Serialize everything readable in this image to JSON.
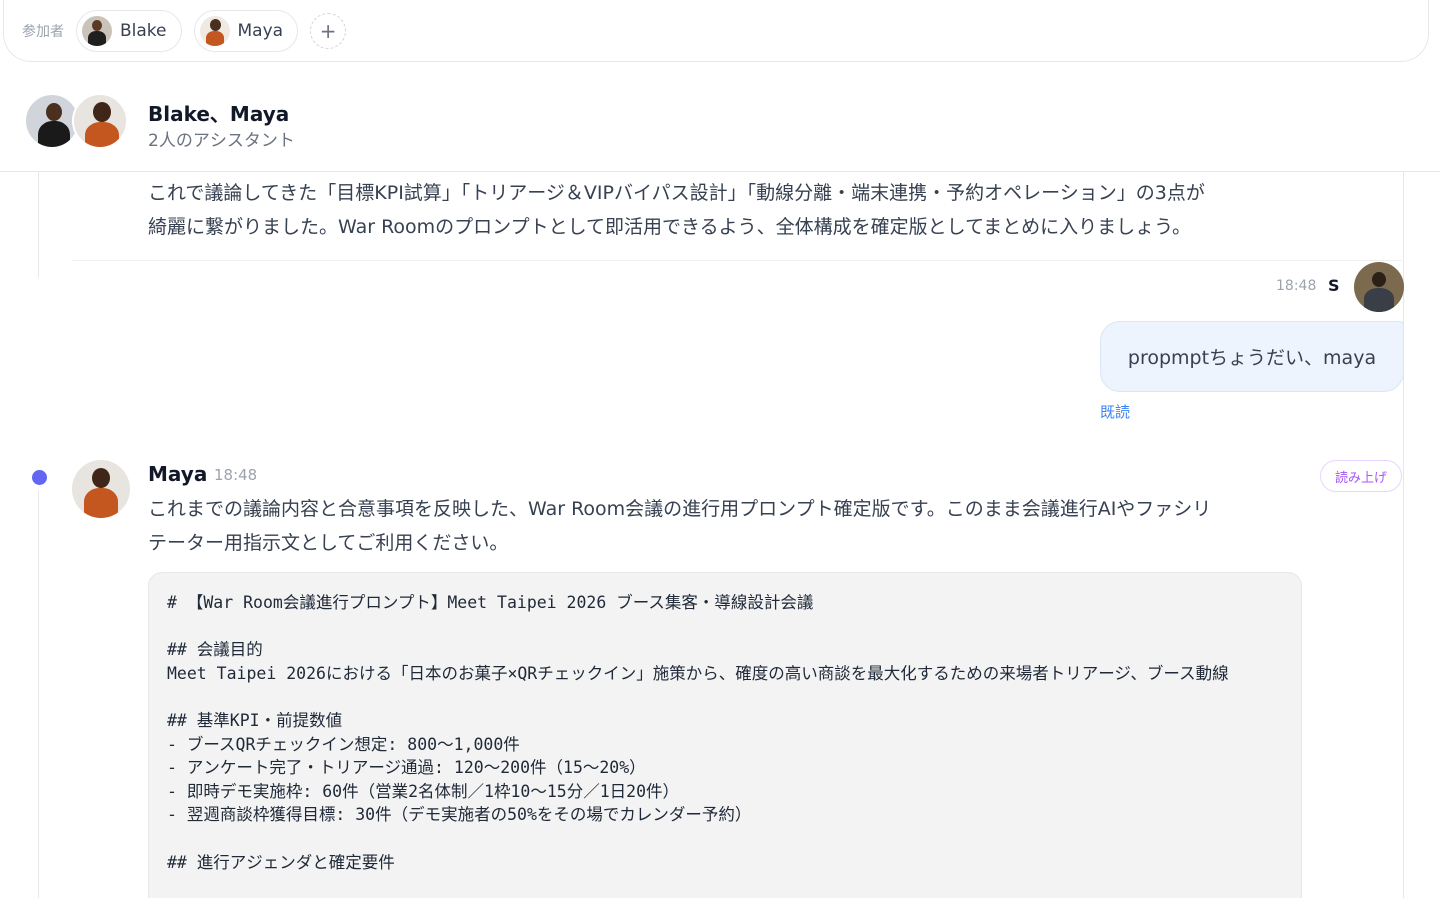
{
  "participants": {
    "label": "参加者",
    "chips": [
      {
        "name": "Blake"
      },
      {
        "name": "Maya"
      }
    ],
    "add_symbol": "+"
  },
  "header": {
    "title": "Blake、Maya",
    "subtitle": "2人のアシスタント"
  },
  "previous_message": {
    "lines": [
      "これで議論してきた「目標KPI試算」「トリアージ＆VIPバイパス設計」「動線分離・端末連携・予約オペレーション」の3点が",
      "綺麗に繋がりました。War Roomのプロンプトとして即活用できるよう、全体構成を確定版としてまとめに入りましょう。"
    ]
  },
  "user_message": {
    "time": "18:48",
    "sender": "S",
    "text": "propmptちょうだい、maya",
    "status": "既読"
  },
  "maya_message": {
    "sender": "Maya",
    "time": "18:48",
    "read_aloud": "読み上げ",
    "lines": [
      "これまでの議論内容と合意事項を反映した、War Room会議の進行用プロンプト確定版です。このまま会議進行AIやファシリ",
      "テーター用指示文としてご利用ください。"
    ],
    "code_lines": [
      "# 【War Room会議進行プロンプト】Meet Taipei 2026 ブース集客・導線設計会議",
      "",
      "## 会議目的",
      "Meet Taipei 2026における「日本のお菓子×QRチェックイン」施策から、確度の高い商談を最大化するための来場者トリアージ、ブース動線",
      "",
      "## 基準KPI・前提数値",
      "- ブースQRチェックイン想定: 800〜1,000件",
      "- アンケート完了・トリアージ通過: 120〜200件（15〜20%）",
      "- 即時デモ実施枠: 60件（営業2名体制／1枠10〜15分／1日20件）",
      "- 翌週商談枠獲得目標: 30件（デモ実施者の50%をその場でカレンダー予約）",
      "",
      "## 進行アジェンダと確定要件"
    ]
  },
  "colors": {
    "accent_dot": "#6366f1",
    "read_status": "#3b82f6",
    "read_aloud": "#a855f7",
    "bubble_bg": "#eef4fd",
    "code_bg": "#f3f3f4"
  },
  "icons": [
    "add-participant-icon",
    "unread-dot-icon"
  ]
}
